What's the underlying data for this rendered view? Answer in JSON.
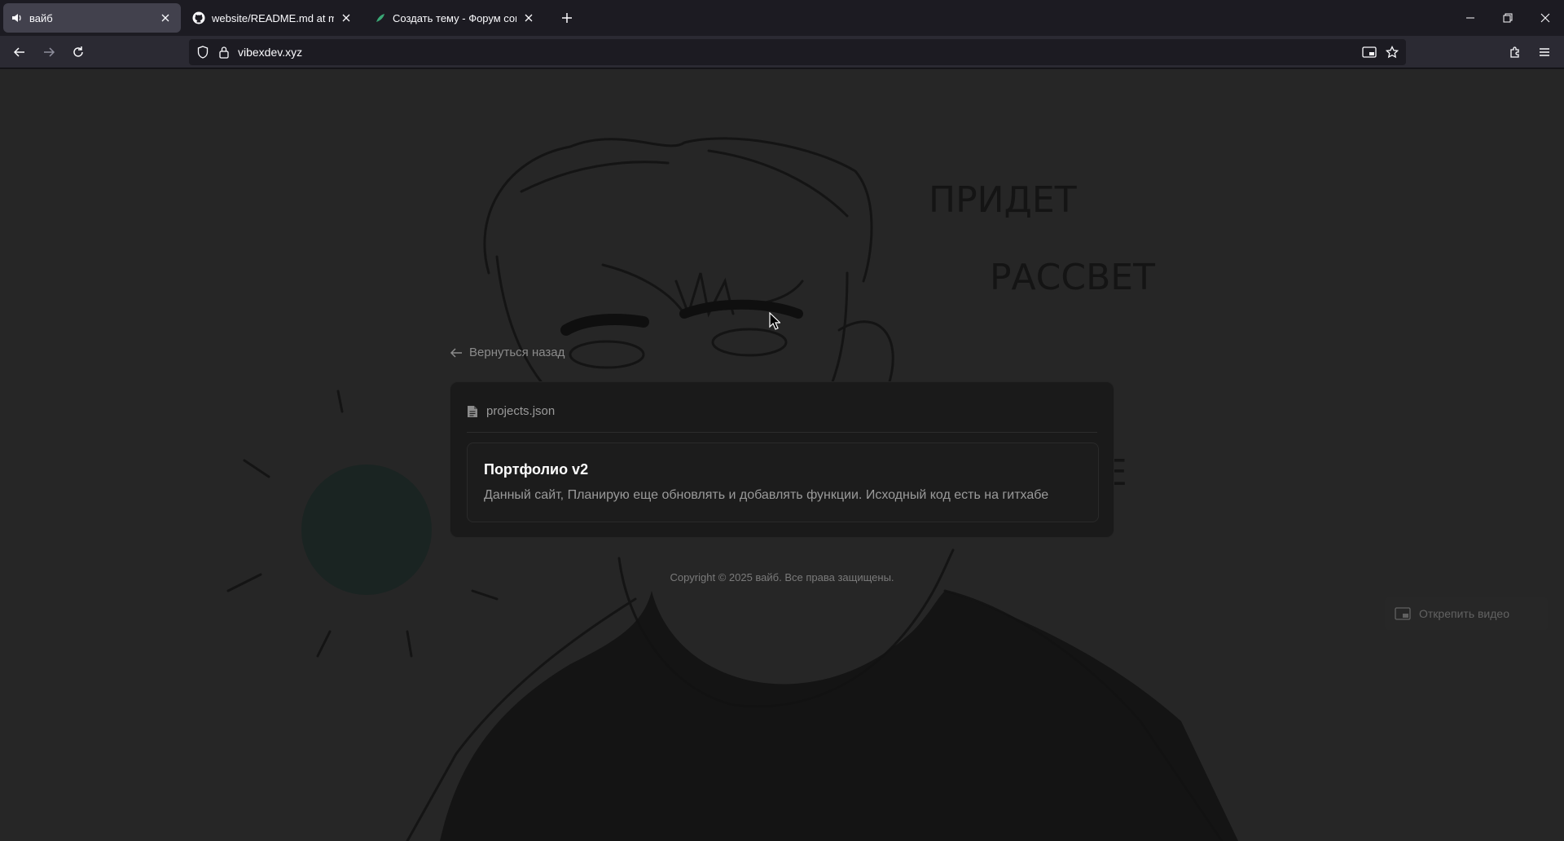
{
  "browser": {
    "tabs": [
      {
        "title": "вайб",
        "active": true,
        "icon": "speaker-icon"
      },
      {
        "title": "website/README.md at main · v",
        "active": false,
        "icon": "github-icon"
      },
      {
        "title": "Создать тему - Форум социал",
        "active": false,
        "icon": "forum-icon"
      }
    ],
    "url": "vibexdev.xyz"
  },
  "page": {
    "back_label": "Вернуться назад",
    "file_name": "projects.json",
    "projects": [
      {
        "title": "Портфолио v2",
        "description": "Данный сайт, Планирую еще обновлять и добавлять функции. Исходный код есть на гитхабе"
      }
    ],
    "copyright": "Copyright © 2025 вайб. Все права защищены.",
    "pip_label": "Открепить видео",
    "art_text": [
      "ПРИДЕТ",
      "РАССВЕТ",
      "ВСЕ"
    ]
  },
  "colors": {
    "chrome_bg": "#1c1b22",
    "toolbar_bg": "#2b2a33",
    "page_bg": "#262626",
    "card_bg": "#1a1a1a"
  }
}
